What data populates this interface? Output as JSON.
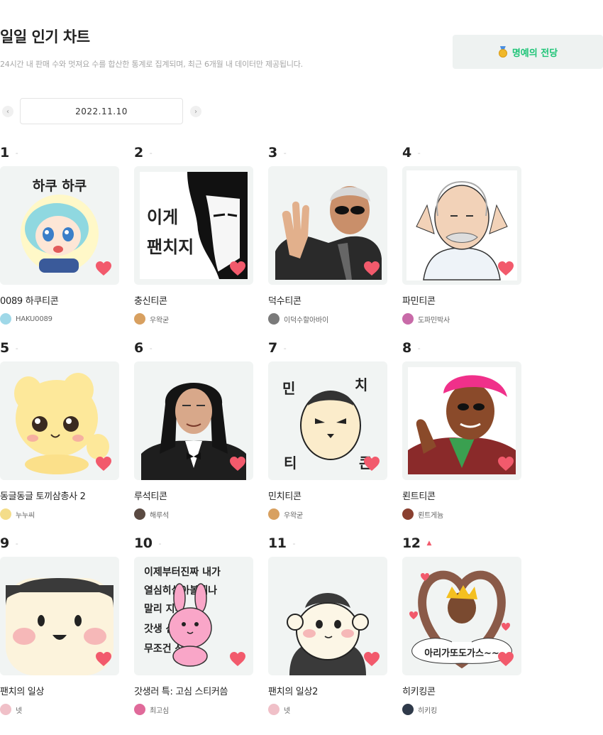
{
  "header": {
    "title": "일일 인기 차트",
    "subtitle": "24시간 내 판매 수와 멋져요 수를 합산한 통계로 집계되며, 최근 6개월 내 데이터만 제공됩니다.",
    "hall_of_fame_label": "명예의 전당"
  },
  "date_nav": {
    "prev_icon": "chevron-left-icon",
    "date": "2022.11.10",
    "next_icon": "chevron-right-icon"
  },
  "colors": {
    "accent_green": "#1ec477",
    "heart_pink": "#f25a6c",
    "thumb_bg": "#f1f4f3"
  },
  "items": [
    {
      "rank": "1",
      "change": "-",
      "title": "0089 하쿠티콘",
      "author": "HAKU0089",
      "art_text": [
        "하쿠 하쿠"
      ],
      "avatar_color": "#9fd8e8"
    },
    {
      "rank": "2",
      "change": "-",
      "title": "충신티콘",
      "author": "우왁굳",
      "art_text": [
        "이게",
        "팬치지"
      ],
      "avatar_color": "#d8a060"
    },
    {
      "rank": "3",
      "change": "-",
      "title": "덕수티콘",
      "author": "이덕수할아바이",
      "art_text": [],
      "avatar_color": "#7a7a7a"
    },
    {
      "rank": "4",
      "change": "-",
      "title": "파민티콘",
      "author": "도파민박사",
      "art_text": [],
      "avatar_color": "#c86aa8"
    },
    {
      "rank": "5",
      "change": "-",
      "title": "동글동글 토끼삼총사 2",
      "author": "누누씨",
      "art_text": [],
      "avatar_color": "#f4dd8a"
    },
    {
      "rank": "6",
      "change": "-",
      "title": "루석티콘",
      "author": "해루석",
      "art_text": [],
      "avatar_color": "#5a4a42"
    },
    {
      "rank": "7",
      "change": "-",
      "title": "민치티콘",
      "author": "우왁굳",
      "art_text": [
        "민",
        "치",
        "티",
        "콘"
      ],
      "avatar_color": "#d8a060"
    },
    {
      "rank": "8",
      "change": "-",
      "title": "뢴트티콘",
      "author": "뢴트게늄",
      "art_text": [],
      "avatar_color": "#8a4030"
    },
    {
      "rank": "9",
      "change": "-",
      "title": "팬치의 일상",
      "author": "넷",
      "art_text": [],
      "avatar_color": "#f0c0c8"
    },
    {
      "rank": "10",
      "change": "-",
      "title": "갓생러 특: 고심 스티커씀",
      "author": "최고심",
      "art_text": [
        "이제부터진짜 내가",
        "열심히살아볼게나",
        "말리      지마",
        "갓생         산다",
        "무조건     산다!"
      ],
      "avatar_color": "#e06a9a"
    },
    {
      "rank": "11",
      "change": "-",
      "title": "팬치의 일상2",
      "author": "넷",
      "art_text": [],
      "avatar_color": "#f0c0c8"
    },
    {
      "rank": "12",
      "change": "▲",
      "title": "히키킹콘",
      "author": "히키킹",
      "art_text": [
        "아리가또도가스~~"
      ],
      "avatar_color": "#2f3a4a"
    }
  ]
}
